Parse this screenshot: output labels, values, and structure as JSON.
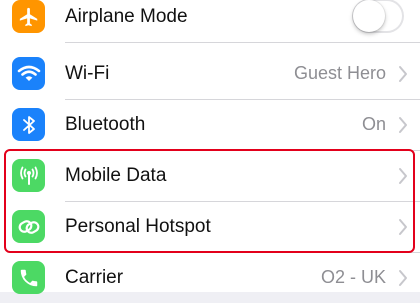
{
  "settings": {
    "rows": [
      {
        "label": "Airplane Mode",
        "value": "",
        "icon": "airplane-icon",
        "icon_bg": "#ff9500",
        "control": "toggle",
        "toggle_on": false
      },
      {
        "label": "Wi-Fi",
        "value": "Guest Hero",
        "icon": "wifi-icon",
        "icon_bg": "#1a82fb",
        "control": "chevron"
      },
      {
        "label": "Bluetooth",
        "value": "On",
        "icon": "bluetooth-icon",
        "icon_bg": "#1a82fb",
        "control": "chevron"
      },
      {
        "label": "Mobile Data",
        "value": "",
        "icon": "antenna-icon",
        "icon_bg": "#4cd964",
        "control": "chevron"
      },
      {
        "label": "Personal Hotspot",
        "value": "",
        "icon": "hotspot-link-icon",
        "icon_bg": "#4cd964",
        "control": "chevron"
      },
      {
        "label": "Carrier",
        "value": "O2 - UK",
        "icon": "phone-icon",
        "icon_bg": "#4cd964",
        "control": "chevron"
      }
    ]
  },
  "highlight_color": "#e3001b"
}
